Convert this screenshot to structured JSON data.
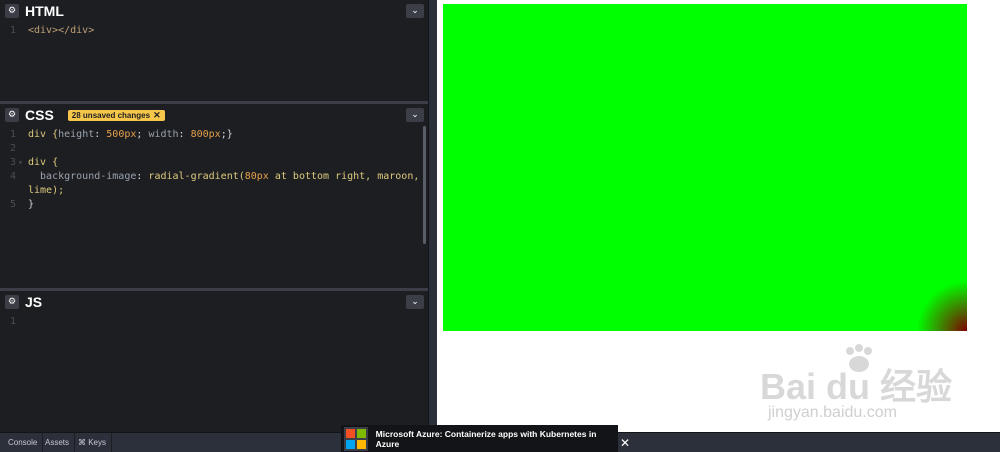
{
  "html_pane": {
    "title": "HTML",
    "lines": [
      {
        "n": "1",
        "tokens": [
          {
            "t": "<div></div>",
            "c": "k-tag"
          }
        ]
      }
    ]
  },
  "css_pane": {
    "title": "CSS",
    "badge": "28 unsaved changes",
    "lines": [
      {
        "n": "1",
        "fold": "",
        "tokens": [
          {
            "t": "div {",
            "c": "k-sel"
          },
          {
            "t": "height",
            "c": "k-prop"
          },
          {
            "t": ": ",
            "c": ""
          },
          {
            "t": "500px",
            "c": "k-num"
          },
          {
            "t": "; ",
            "c": ""
          },
          {
            "t": "width",
            "c": "k-prop"
          },
          {
            "t": ": ",
            "c": ""
          },
          {
            "t": "800px",
            "c": "k-num"
          },
          {
            "t": ";}",
            "c": ""
          }
        ]
      },
      {
        "n": "2",
        "fold": "",
        "tokens": []
      },
      {
        "n": "3",
        "fold": "▾",
        "tokens": [
          {
            "t": "div {",
            "c": "k-sel"
          }
        ]
      },
      {
        "n": "4",
        "fold": "",
        "tokens": [
          {
            "t": "  background-image",
            "c": "k-prop"
          },
          {
            "t": ": ",
            "c": ""
          },
          {
            "t": "radial-gradient(",
            "c": "k-fn"
          },
          {
            "t": "80px",
            "c": "k-num"
          },
          {
            "t": " at bottom right, maroon,",
            "c": "k-fn"
          }
        ]
      },
      {
        "n": "",
        "fold": "",
        "tokens": [
          {
            "t": "lime);",
            "c": "k-fn"
          }
        ]
      },
      {
        "n": "5",
        "fold": "",
        "tokens": [
          {
            "t": "}",
            "c": ""
          }
        ]
      }
    ]
  },
  "js_pane": {
    "title": "JS",
    "lines": [
      {
        "n": "1",
        "tokens": []
      }
    ]
  },
  "bottom_bar": {
    "console": "Console",
    "assets": "Assets",
    "keys": "⌘ Keys"
  },
  "ad": {
    "text": "Microsoft Azure: Containerize apps with Kubernetes in Azure",
    "close": "✕",
    "logo_colors": [
      "#f25022",
      "#7fba00",
      "#00a4ef",
      "#ffb900"
    ]
  },
  "icons": {
    "gear": "⚙",
    "chevron": "⌄",
    "badge_close": "✕"
  },
  "watermark": {
    "brand": "Bai  du 经验",
    "url": "jingyan.baidu.com"
  }
}
